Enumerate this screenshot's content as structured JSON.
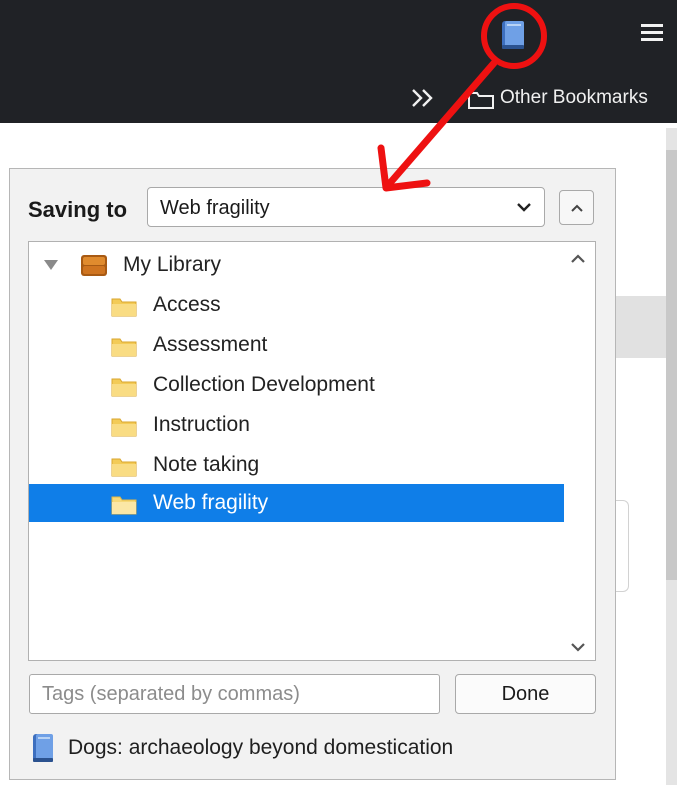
{
  "browser": {
    "bookmarks_toolbar": {
      "overflow_icon": "double-chevron-right-icon",
      "folder_icon": "folder-outline-icon",
      "other_bookmarks_label": "Other Bookmarks"
    },
    "toolbar_icons": [
      "zotero-save-icon",
      "hamburger-menu-icon"
    ]
  },
  "zotero_panel": {
    "saving_to_label": "Saving to",
    "selected_collection": "Web fragility",
    "tree": {
      "root": {
        "label": "My Library",
        "expanded": true,
        "icon": "library-icon"
      },
      "collections": [
        {
          "label": "Access",
          "selected": false,
          "icon": "folder-icon"
        },
        {
          "label": "Assessment",
          "selected": false,
          "icon": "folder-icon"
        },
        {
          "label": "Collection Development",
          "selected": false,
          "icon": "folder-icon"
        },
        {
          "label": "Instruction",
          "selected": false,
          "icon": "folder-icon"
        },
        {
          "label": "Note taking",
          "selected": false,
          "icon": "folder-icon"
        },
        {
          "label": "Web fragility",
          "selected": true,
          "icon": "folder-icon"
        }
      ]
    },
    "tags_placeholder": "Tags (separated by commas)",
    "done_label": "Done",
    "saved_item": {
      "icon": "book-icon",
      "title": "Dogs: archaeology beyond domestication"
    }
  },
  "colors": {
    "toolbar_bg": "#202226",
    "selection": "#0f7ee8",
    "annotation_red": "#ee1111",
    "book_blue": "#4a78c0",
    "folder_yellow": "#f3cb57"
  }
}
